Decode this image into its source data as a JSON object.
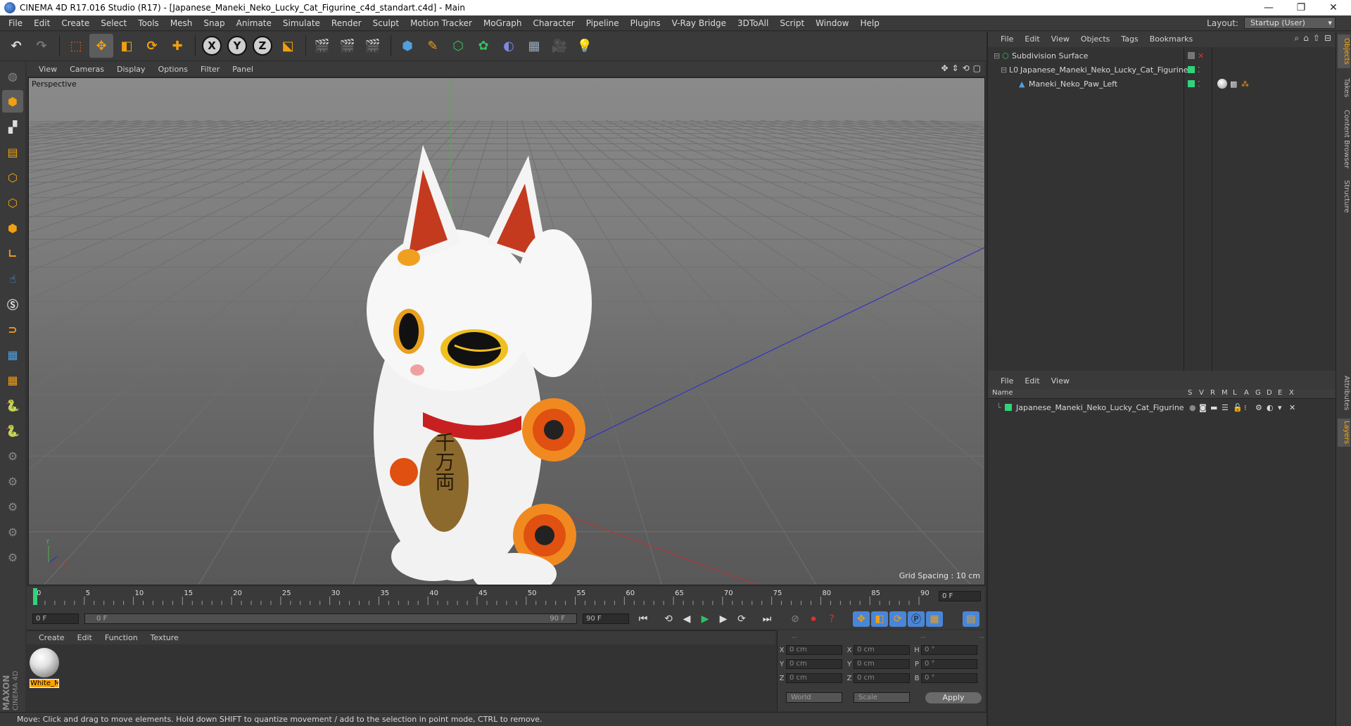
{
  "window": {
    "title": "CINEMA 4D R17.016 Studio (R17) - [Japanese_Maneki_Neko_Lucky_Cat_Figurine_c4d_standart.c4d] - Main",
    "controls": [
      "—",
      "❐",
      "✕"
    ]
  },
  "menubar": {
    "items": [
      "File",
      "Edit",
      "Create",
      "Select",
      "Tools",
      "Mesh",
      "Snap",
      "Animate",
      "Simulate",
      "Render",
      "Sculpt",
      "Motion Tracker",
      "MoGraph",
      "Character",
      "Pipeline",
      "Plugins",
      "V-Ray Bridge",
      "3DToAll",
      "Script",
      "Window",
      "Help"
    ],
    "layout_label": "Layout:",
    "layout_value": "Startup (User)"
  },
  "toolbar": {
    "axis_x": "X",
    "axis_y": "Y",
    "axis_z": "Z"
  },
  "viewport": {
    "menu": [
      "View",
      "Cameras",
      "Display",
      "Options",
      "Filter",
      "Panel"
    ],
    "label": "Perspective",
    "grid_spacing": "Grid Spacing : 10 cm",
    "seal_text": "千万両"
  },
  "timeline": {
    "ticks": [
      "0",
      "5",
      "10",
      "15",
      "20",
      "25",
      "30",
      "35",
      "40",
      "45",
      "50",
      "55",
      "60",
      "65",
      "70",
      "75",
      "80",
      "85",
      "90"
    ],
    "current_frame": "0 F",
    "start_field": "0 F",
    "range_start": "0 F",
    "range_end": "90 F",
    "end_field": "90 F"
  },
  "material_manager": {
    "menu": [
      "Create",
      "Edit",
      "Function",
      "Texture"
    ],
    "materials": [
      {
        "name": "White_M"
      }
    ]
  },
  "coordinates": {
    "header": [
      "--",
      "--",
      "--"
    ],
    "rows": [
      {
        "l1": "X",
        "v1": "0 cm",
        "l2": "X",
        "v2": "0 cm",
        "l3": "H",
        "v3": "0 °"
      },
      {
        "l1": "Y",
        "v1": "0 cm",
        "l2": "Y",
        "v2": "0 cm",
        "l3": "P",
        "v3": "0 °"
      },
      {
        "l1": "Z",
        "v1": "0 cm",
        "l2": "Z",
        "v2": "0 cm",
        "l3": "B",
        "v3": "0 °"
      }
    ],
    "mode1": "World",
    "mode2": "Scale",
    "apply": "Apply"
  },
  "status": {
    "text": "Move: Click and drag to move elements. Hold down SHIFT to quantize movement / add to the selection in point mode, CTRL to remove."
  },
  "object_manager": {
    "menu": [
      "File",
      "Edit",
      "View",
      "Objects",
      "Tags",
      "Bookmarks"
    ],
    "objects": [
      {
        "name": "Subdivision Surface"
      },
      {
        "name": "Japanese_Maneki_Neko_Lucky_Cat_Figurine"
      },
      {
        "name": "Maneki_Neko_Paw_Left"
      }
    ]
  },
  "layer_manager": {
    "menu": [
      "File",
      "Edit",
      "View"
    ],
    "header_name": "Name",
    "columns": [
      "S",
      "V",
      "R",
      "M",
      "L",
      "A",
      "G",
      "D",
      "E",
      "X"
    ],
    "layers": [
      {
        "name": "Japanese_Maneki_Neko_Lucky_Cat_Figurine"
      }
    ]
  },
  "side_tabs": [
    "Objects",
    "Takes",
    "Content Browser",
    "Structure",
    "Attributes",
    "Layers"
  ],
  "logo": {
    "line1": "MAXON",
    "line2": "CINEMA 4D"
  },
  "colors": {
    "accent": "#ffa500",
    "layer_green": "#2fd47a",
    "active_tab": "#ffa500"
  }
}
